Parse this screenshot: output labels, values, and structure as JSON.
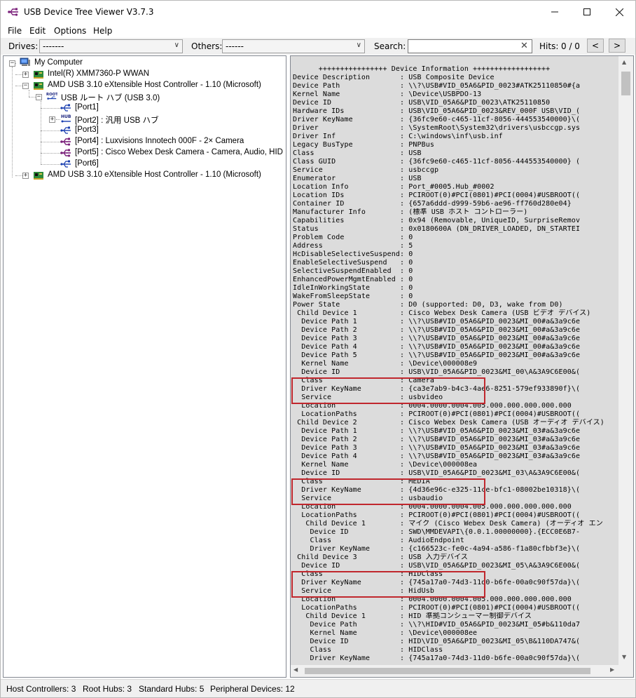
{
  "window": {
    "title": "USB Device Tree Viewer V3.7.3"
  },
  "menu": [
    "File",
    "Edit",
    "Options",
    "Help"
  ],
  "toolbar": {
    "drives_label": "Drives:",
    "drives_value": "-------",
    "others_label": "Others:",
    "others_value": "------",
    "search_label": "Search:",
    "search_value": "",
    "hits_label": "Hits:",
    "hits_value": "0 / 0",
    "prev": "<",
    "next": ">"
  },
  "tree": [
    {
      "label": "My Computer",
      "icon": "computer-icon"
    },
    {
      "label": "Intel(R) XMM7360-P WWAN",
      "icon": "controller-icon"
    },
    {
      "label": "AMD USB 3.10 eXtensible Host Controller - 1.10 (Microsoft)",
      "icon": "controller-icon"
    },
    {
      "label": "USB ルート ハブ (USB 3.0)",
      "icon": "root-hub-icon",
      "icon_text": "ROOT"
    },
    {
      "label": "[Port1]",
      "icon": "usb-port-icon"
    },
    {
      "label": "[Port2] : 汎用 USB ハブ",
      "icon": "hub-icon",
      "icon_text": "HUB"
    },
    {
      "label": "[Port3]",
      "icon": "usb-port-icon"
    },
    {
      "label": "[Port4] : Luxvisions Innotech 000F - 2× Camera",
      "icon": "usb-device-icon"
    },
    {
      "label": "[Port5] : Cisco Webex Desk Camera - Camera, Audio, HID",
      "icon": "usb-device-icon"
    },
    {
      "label": "[Port6]",
      "icon": "usb-port-icon"
    },
    {
      "label": "AMD USB 3.10 eXtensible Host Controller - 1.10 (Microsoft)",
      "icon": "controller-icon"
    }
  ],
  "info": {
    "lines": [
      "      ++++++++++++++++ Device Information ++++++++++++++++++",
      "Device Description       : USB Composite Device",
      "Device Path              : \\\\?\\USB#VID_05A6&PID_0023#ATK25110850#{a",
      "Kernel Name              : \\Device\\USBPDO-13",
      "Device ID                : USB\\VID_05A6&PID_0023\\ATK25110850",
      "Hardware IDs             : USB\\VID_05A6&PID_0023&REV_000F USB\\VID_(",
      "Driver KeyName           : {36fc9e60-c465-11cf-8056-444553540000}\\(",
      "Driver                   : \\SystemRoot\\System32\\drivers\\usbccgp.sys",
      "Driver Inf               : C:\\windows\\inf\\usb.inf",
      "Legacy BusType           : PNPBus",
      "Class                    : USB",
      "Class GUID               : {36fc9e60-c465-11cf-8056-444553540000} (",
      "Service                  : usbccgp",
      "Enumerator               : USB",
      "Location Info            : Port_#0005.Hub_#0002",
      "Location IDs             : PCIROOT(0)#PCI(0801)#PCI(0004)#USBROOT((",
      "Container ID             : {657a6ddd-d999-59b6-ae96-ff760d280e04}",
      "Manufacturer Info        : (標準 USB ホスト コントローラー)",
      "Capabilities             : 0x94 (Removable, UniqueID, SurpriseRemov",
      "Status                   : 0x0180600A (DN_DRIVER_LOADED, DN_STARTEI",
      "Problem Code             : 0",
      "Address                  : 5",
      "HcDisableSelectiveSuspend: 0",
      "EnableSelectiveSuspend   : 0",
      "SelectiveSuspendEnabled  : 0",
      "EnhancedPowerMgmtEnabled : 0",
      "IdleInWorkingState       : 0",
      "WakeFromSleepState       : 0",
      "Power State              : D0 (supported: D0, D3, wake from D0)",
      " Child Device 1          : Cisco Webex Desk Camera (USB ビデオ デバイス)",
      "  Device Path 1          : \\\\?\\USB#VID_05A6&PID_0023&MI_00#a&3a9c6e",
      "  Device Path 2          : \\\\?\\USB#VID_05A6&PID_0023&MI_00#a&3a9c6e",
      "  Device Path 3          : \\\\?\\USB#VID_05A6&PID_0023&MI_00#a&3a9c6e",
      "  Device Path 4          : \\\\?\\USB#VID_05A6&PID_0023&MI_00#a&3a9c6e",
      "  Device Path 5          : \\\\?\\USB#VID_05A6&PID_0023&MI_00#a&3a9c6e",
      "  Kernel Name            : \\Device\\000008e9",
      "  Device ID              : USB\\VID_05A6&PID_0023&MI_00\\A&3A9C6E00&(",
      "  Class                  : Camera",
      "  Driver KeyName         : {ca3e7ab9-b4c3-4ae6-8251-579ef933890f}\\(",
      "  Service                : usbvideo",
      "  Location               : 0004.0000.0004.005.000.000.000.000.000",
      "  LocationPaths          : PCIROOT(0)#PCI(0801)#PCI(0004)#USBROOT((",
      " Child Device 2          : Cisco Webex Desk Camera (USB オーディオ デバイス)",
      "  Device Path 1          : \\\\?\\USB#VID_05A6&PID_0023&MI_03#a&3a9c6e",
      "  Device Path 2          : \\\\?\\USB#VID_05A6&PID_0023&MI_03#a&3a9c6e",
      "  Device Path 3          : \\\\?\\USB#VID_05A6&PID_0023&MI_03#a&3a9c6e",
      "  Device Path 4          : \\\\?\\USB#VID_05A6&PID_0023&MI_03#a&3a9c6e",
      "  Kernel Name            : \\Device\\000008ea",
      "  Device ID              : USB\\VID_05A6&PID_0023&MI_03\\A&3A9C6E00&(",
      "  Class                  : MEDIA",
      "  Driver KeyName         : {4d36e96c-e325-11ce-bfc1-08002be10318}\\(",
      "  Service                : usbaudio",
      "  Location               : 0004.0000.0004.005.000.000.000.000.000",
      "  LocationPaths          : PCIROOT(0)#PCI(0801)#PCI(0004)#USBROOT((",
      "   Child Device 1        : マイク (Cisco Webex Desk Camera) (オーディオ エン",
      "    Device ID            : SWD\\MMDEVAPI\\{0.0.1.00000000}.{ECC0E6B7-",
      "    Class                : AudioEndpoint",
      "    Driver KeyName       : {c166523c-fe0c-4a94-a586-f1a80cfbbf3e}\\(",
      " Child Device 3          : USB 入力デバイス",
      "  Device ID              : USB\\VID_05A6&PID_0023&MI_05\\A&3A9C6E00&(",
      "  Class                  : HIDClass",
      "  Driver KeyName         : {745a17a0-74d3-11d0-b6fe-00a0c90f57da}\\(",
      "  Service                : HidUsb",
      "  Location               : 0004.0000.0004.005.000.000.000.000.000",
      "  LocationPaths          : PCIROOT(0)#PCI(0801)#PCI(0004)#USBROOT((",
      "   Child Device 1        : HID 準拠コンシューマー制御デバイス",
      "    Device Path          : \\\\?\\HID#VID_05A6&PID_0023&MI_05#b&110da7",
      "    Kernel Name          : \\Device\\000008ee",
      "    Device ID            : HID\\VID_05A6&PID_0023&MI_05\\B&110DA747&(",
      "    Class                : HIDClass",
      "    Driver KeyName       : {745a17a0-74d3-11d0-b6fe-00a0c90f57da}\\("
    ]
  },
  "highlight_color": "#c0272d",
  "status": {
    "host_controllers": "Host Controllers: 3",
    "root_hubs": "Root Hubs: 3",
    "standard_hubs": "Standard Hubs: 5",
    "peripheral_devices": "Peripheral Devices: 12"
  }
}
